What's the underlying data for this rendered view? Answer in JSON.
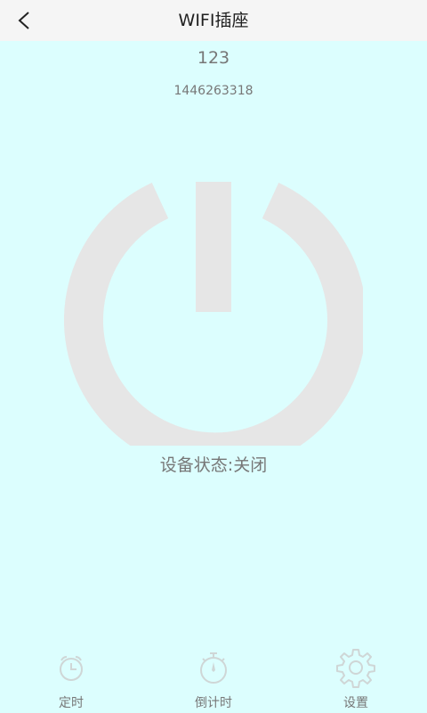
{
  "header": {
    "title": "WIFI插座",
    "back_icon": "chevron-left-icon"
  },
  "device": {
    "name": "123",
    "id": "1446263318"
  },
  "power": {
    "icon": "power-icon",
    "color": "#e6e6e6"
  },
  "status": {
    "label": "设备状态:",
    "value": "关闭"
  },
  "tabs": [
    {
      "label": "定时",
      "icon": "alarm-clock-icon"
    },
    {
      "label": "倒计时",
      "icon": "stopwatch-icon"
    },
    {
      "label": "设置",
      "icon": "gear-icon"
    }
  ],
  "colors": {
    "background": "#dcfefe",
    "header": "#f5f5f5",
    "text_gray": "#777777",
    "icon_gray": "#cfd6d6"
  }
}
